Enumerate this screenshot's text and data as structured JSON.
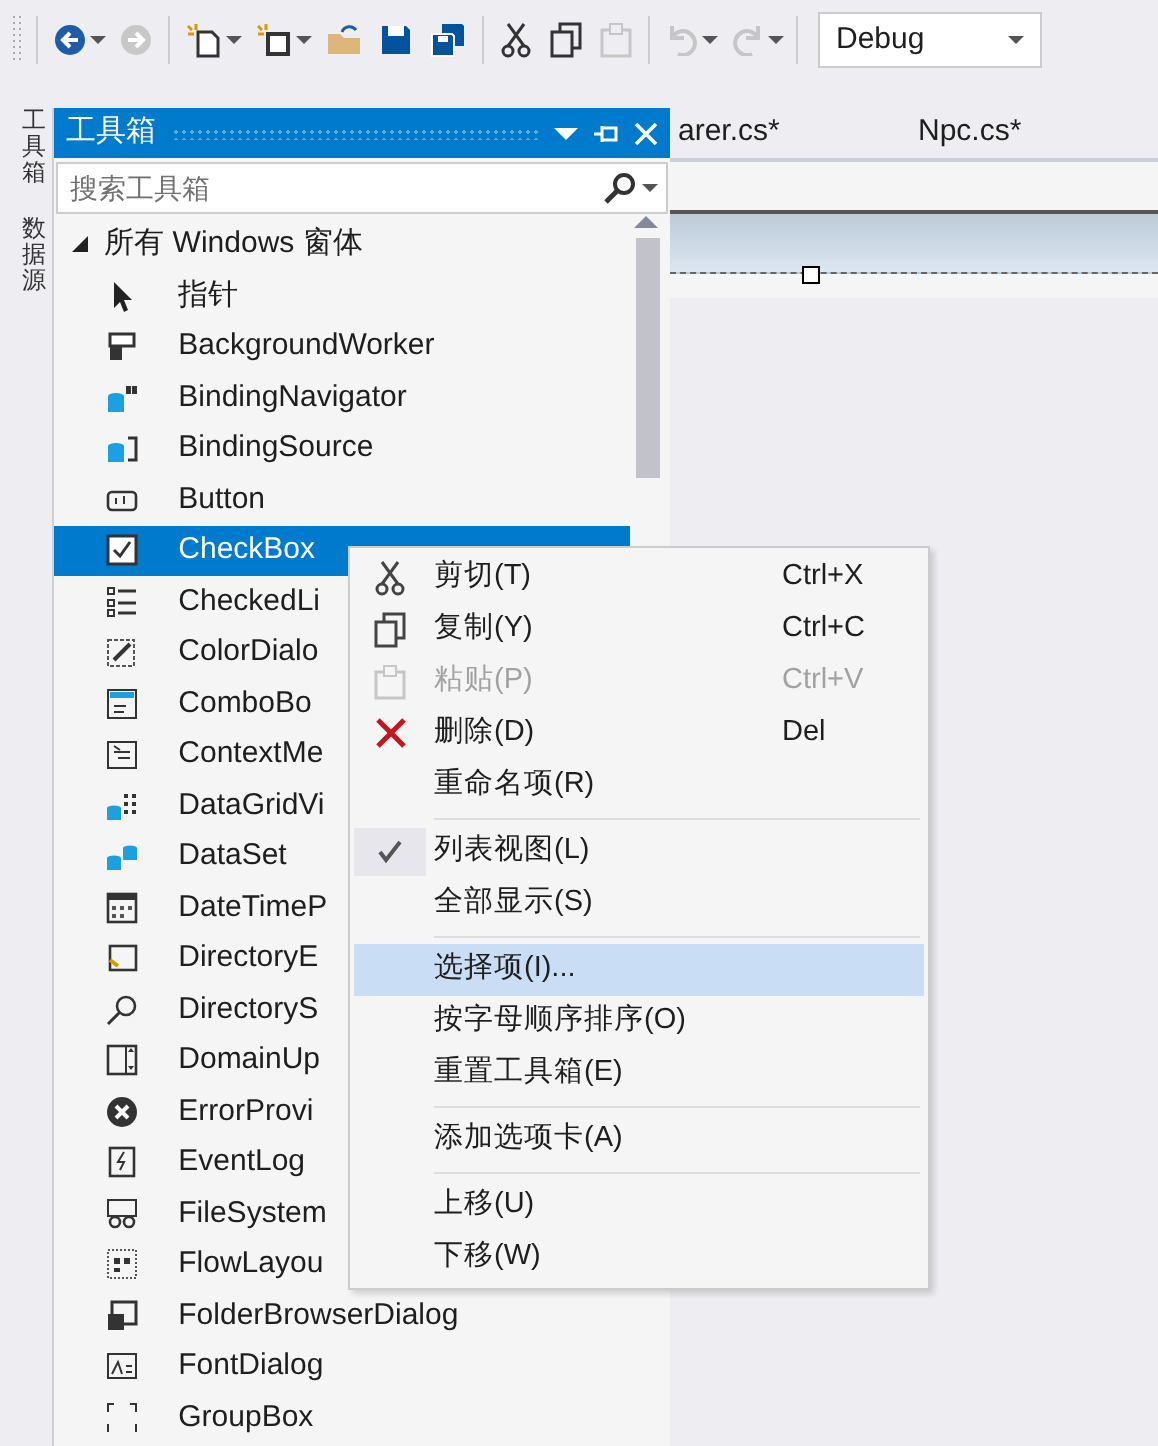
{
  "toolbar": {
    "configuration": "Debug"
  },
  "side_tabs": [
    {
      "label": "工具箱"
    },
    {
      "label": "数据源"
    }
  ],
  "toolbox": {
    "title": "工具箱",
    "search": {
      "placeholder": "搜索工具箱"
    },
    "group": {
      "label": "所有 Windows 窗体",
      "expanded": true,
      "items": [
        {
          "label": "指针",
          "selected": false
        },
        {
          "label": "BackgroundWorker",
          "selected": false
        },
        {
          "label": "BindingNavigator",
          "selected": false
        },
        {
          "label": "BindingSource",
          "selected": false
        },
        {
          "label": "Button",
          "selected": false
        },
        {
          "label": "CheckBox",
          "selected": true
        },
        {
          "label": "CheckedLi",
          "selected": false
        },
        {
          "label": "ColorDialo",
          "selected": false
        },
        {
          "label": "ComboBo",
          "selected": false
        },
        {
          "label": "ContextMe",
          "selected": false
        },
        {
          "label": "DataGridVi",
          "selected": false
        },
        {
          "label": "DataSet",
          "selected": false
        },
        {
          "label": "DateTimeP",
          "selected": false
        },
        {
          "label": "DirectoryE",
          "selected": false
        },
        {
          "label": "DirectoryS",
          "selected": false
        },
        {
          "label": "DomainUp",
          "selected": false
        },
        {
          "label": "ErrorProvi",
          "selected": false
        },
        {
          "label": "EventLog",
          "selected": false
        },
        {
          "label": "FileSystem",
          "selected": false
        },
        {
          "label": "FlowLayou",
          "selected": false
        },
        {
          "label": "FolderBrowserDialog",
          "selected": false
        },
        {
          "label": "FontDialog",
          "selected": false
        },
        {
          "label": "GroupBox",
          "selected": false
        }
      ]
    }
  },
  "editor_tabs": [
    {
      "label": "arer.cs*"
    },
    {
      "label": "Npc.cs*"
    }
  ],
  "context_menu": {
    "items": [
      {
        "kind": "item",
        "label": "剪切(T)",
        "shortcut": "Ctrl+X",
        "disabled": false,
        "checked": false,
        "selected": false
      },
      {
        "kind": "item",
        "label": "复制(Y)",
        "shortcut": "Ctrl+C",
        "disabled": false,
        "checked": false,
        "selected": false
      },
      {
        "kind": "item",
        "label": "粘贴(P)",
        "shortcut": "Ctrl+V",
        "disabled": true,
        "checked": false,
        "selected": false
      },
      {
        "kind": "item",
        "label": "删除(D)",
        "shortcut": "Del",
        "disabled": false,
        "checked": false,
        "selected": false
      },
      {
        "kind": "item",
        "label": "重命名项(R)",
        "disabled": false,
        "checked": false,
        "selected": false
      },
      {
        "kind": "separator"
      },
      {
        "kind": "item",
        "label": "列表视图(L)",
        "disabled": false,
        "checked": true,
        "selected": false
      },
      {
        "kind": "item",
        "label": "全部显示(S)",
        "disabled": false,
        "checked": false,
        "selected": false
      },
      {
        "kind": "separator"
      },
      {
        "kind": "item",
        "label": "选择项(I)...",
        "disabled": false,
        "checked": false,
        "selected": true
      },
      {
        "kind": "item",
        "label": "按字母顺序排序(O)",
        "disabled": false,
        "checked": false,
        "selected": false
      },
      {
        "kind": "item",
        "label": "重置工具箱(E)",
        "disabled": false,
        "checked": false,
        "selected": false
      },
      {
        "kind": "separator"
      },
      {
        "kind": "item",
        "label": "添加选项卡(A)",
        "disabled": false,
        "checked": false,
        "selected": false
      },
      {
        "kind": "separator"
      },
      {
        "kind": "item",
        "label": "上移(U)",
        "disabled": false,
        "checked": false,
        "selected": false
      },
      {
        "kind": "item",
        "label": "下移(W)",
        "disabled": false,
        "checked": false,
        "selected": false
      }
    ]
  }
}
